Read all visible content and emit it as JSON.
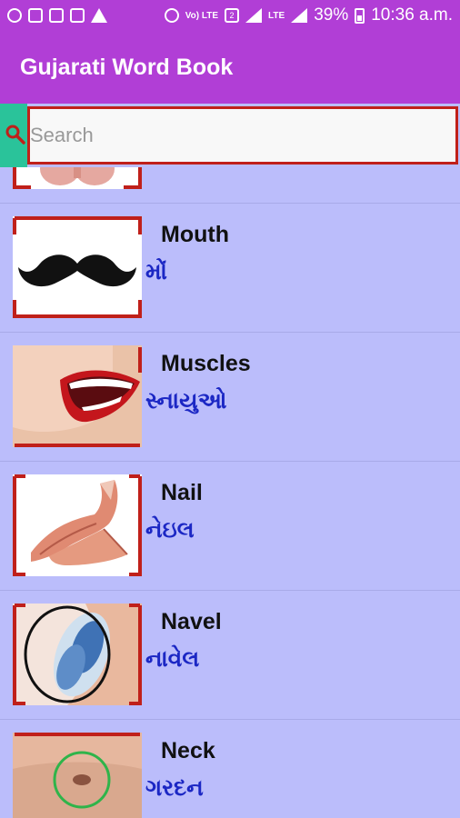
{
  "status_bar": {
    "battery": "39%",
    "time": "10:36 a.m.",
    "network": "LTE",
    "sim_badge": "2",
    "volte": "Vo) LTE"
  },
  "app": {
    "title": "Gujarati Word Book"
  },
  "search": {
    "placeholder": "Search",
    "value": ""
  },
  "words": [
    {
      "english": "Mouth",
      "gujarati": "મોં",
      "image": "mustache-image"
    },
    {
      "english": "Muscles",
      "gujarati": "સ્નાયુઓ",
      "image": "mouth-image"
    },
    {
      "english": "Nail",
      "gujarati": "નેઇલ",
      "image": "arm-muscle-image"
    },
    {
      "english": "Navel",
      "gujarati": "નાવેલ",
      "image": "fingernail-image"
    },
    {
      "english": "Neck",
      "gujarati": "ગરદન",
      "image": "navel-image"
    }
  ],
  "colors": {
    "app_bar": "#b13ed6",
    "list_background": "#bbbdfb",
    "gujarati_text": "#1b27c4",
    "frame_red": "#c0201a",
    "search_accent": "#2ac39a"
  }
}
